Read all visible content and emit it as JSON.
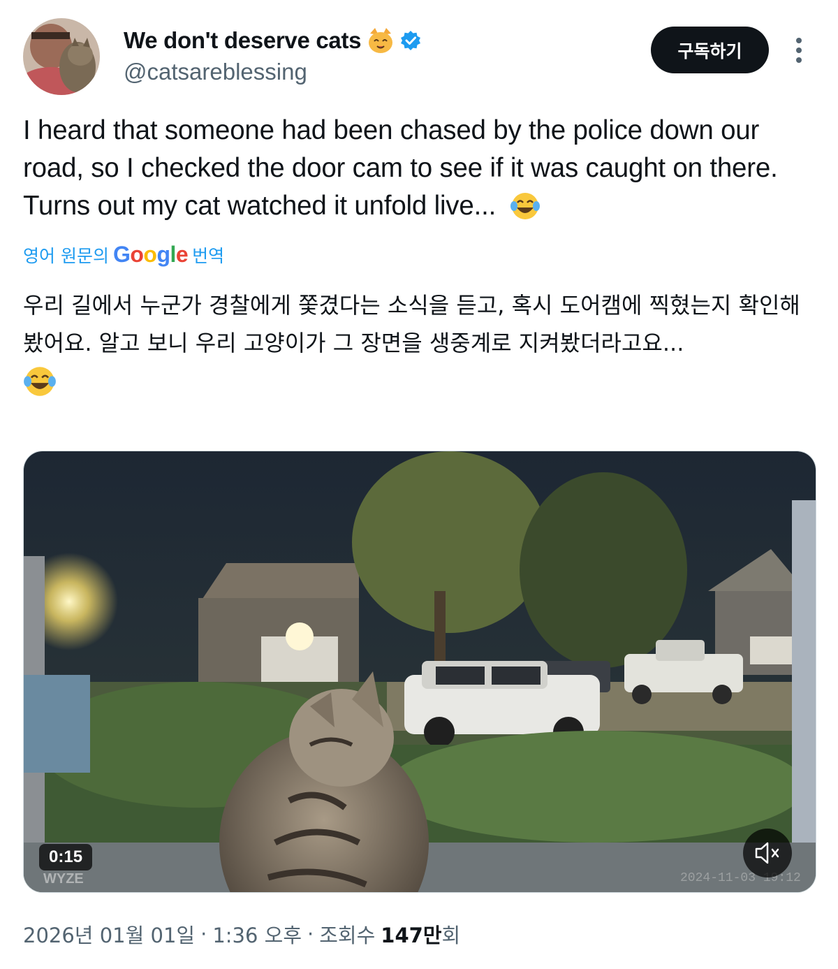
{
  "author": {
    "display_name": "We don't deserve cats",
    "handle": "@catsareblessing",
    "verified": true,
    "name_emoji": "cat-face-emoji"
  },
  "actions": {
    "subscribe_label": "구독하기"
  },
  "tweet": {
    "text": "I heard that someone had been chased by the police down our road, so I checked the door cam to see if it was caught on there. Turns out my cat watched it unfold live...",
    "text_emoji": "tears-of-joy-emoji",
    "translation_prefix": "영어 원문의",
    "translation_brand": "Google",
    "translation_suffix": "번역",
    "translated_text": "우리 길에서 누군가 경찰에게 쫓겼다는 소식을 듣고, 혹시 도어캠에 찍혔는지 확인해 봤어요. 알고 보니 우리 고양이가 그 장면을 생중계로 지켜봤더라고요...",
    "translated_emoji": "tears-of-joy-emoji"
  },
  "media": {
    "duration": "0:15",
    "mute_icon": "muted-speaker-icon"
  },
  "meta": {
    "date": "2026년 01월 01일",
    "separator": "·",
    "time": "1:36 오후",
    "views_label": "조회수",
    "views_count": "147만",
    "views_suffix": "회"
  },
  "colors": {
    "accent": "#1d9bf0",
    "text_primary": "#0f1419",
    "text_secondary": "#536471",
    "button_bg": "#0f1419"
  }
}
